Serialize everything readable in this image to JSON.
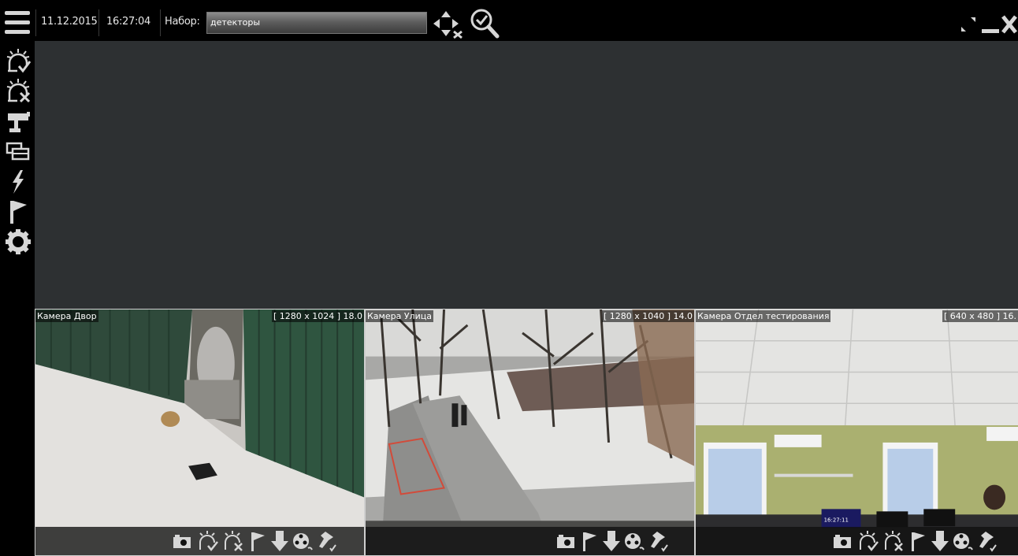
{
  "topbar": {
    "date": "11.12.2015",
    "time": "16:27:04",
    "set_label": "Набор:",
    "set_value": "детекторы"
  },
  "sidebar": {
    "items": [
      {
        "icon": "alarm-confirm-icon"
      },
      {
        "icon": "alarm-cancel-icon"
      },
      {
        "icon": "camera-icon"
      },
      {
        "icon": "layouts-icon"
      },
      {
        "icon": "events-lightning-icon"
      },
      {
        "icon": "flag-icon"
      },
      {
        "icon": "settings-gear-icon"
      }
    ]
  },
  "cameras": [
    {
      "name": "Камера Двор",
      "resolution": "[ 1280 x 1024 ] 18.0"
    },
    {
      "name": "Камера Улица",
      "resolution": "[ 1280 x 1040 ] 14.0"
    },
    {
      "name": "Камера Отдел тестирования",
      "resolution": "[ 640 x 480 ] 16."
    }
  ],
  "overlay_clock": "16:27:11",
  "colors": {
    "main_bg": "#2d3032",
    "bar_bg": "#000000",
    "icon": "#d6d6d6"
  }
}
